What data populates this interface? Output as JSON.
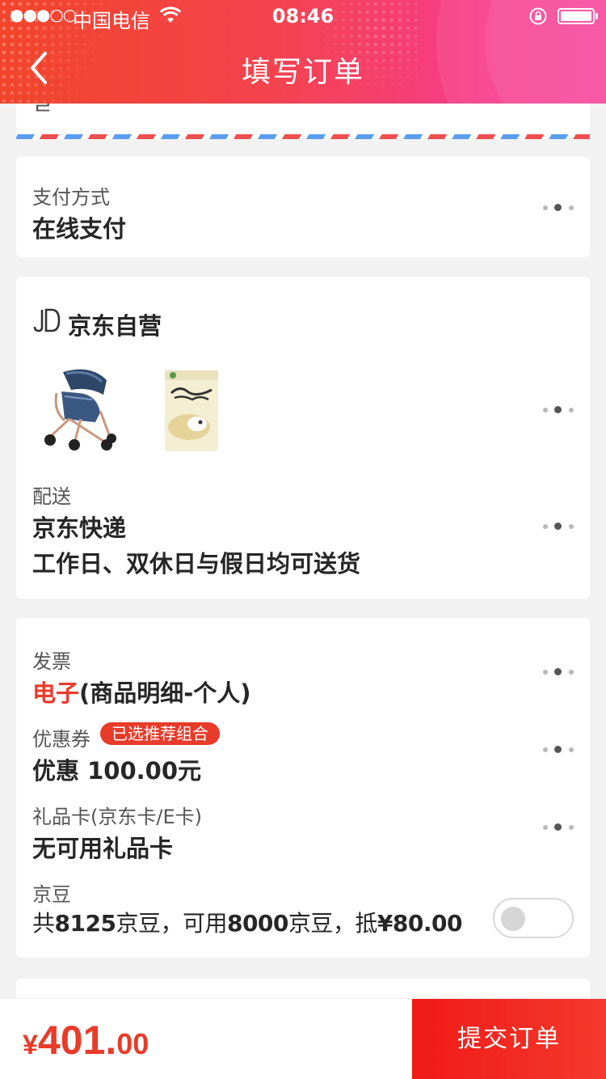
{
  "status_bar": {
    "signal": "●●●○○",
    "carrier": "中国电信",
    "time": "08:46"
  },
  "nav": {
    "title": "填写订单",
    "back_icon": "chevron-left-icon"
  },
  "address": {
    "cut_text": "ㄹ"
  },
  "payment": {
    "label": "支付方式",
    "value": "在线支付"
  },
  "shop": {
    "name": "京东自营",
    "logo_icon": "jd-logo-icon",
    "products": [
      {
        "icon": "stroller-image"
      },
      {
        "icon": "snack-bag-image"
      }
    ],
    "delivery_label": "配送",
    "delivery_method": "京东快递",
    "delivery_note": "工作日、双休日与假日均可送货"
  },
  "invoice": {
    "label": "发票",
    "type_highlight": "电子",
    "type_rest": "(商品明细-个人)"
  },
  "coupon": {
    "label": "优惠券",
    "badge": "已选推荐组合",
    "value": "优惠 100.00元"
  },
  "gift_card": {
    "label": "礼品卡(京东卡/E卡)",
    "value": "无可用礼品卡"
  },
  "jingdou": {
    "label": "京豆",
    "t1": "共",
    "total": "8125",
    "t2": "京豆，可用",
    "usable": "8000",
    "t3": "京豆，抵",
    "deduct": "¥80.00",
    "toggle_on": false
  },
  "footer": {
    "currency": "¥",
    "amount_int": "401.",
    "amount_dec": "00",
    "submit_label": "提交订单"
  },
  "colors": {
    "accent": "#e93b2a",
    "header_start": "#f2452b",
    "header_end": "#f93d9a"
  }
}
